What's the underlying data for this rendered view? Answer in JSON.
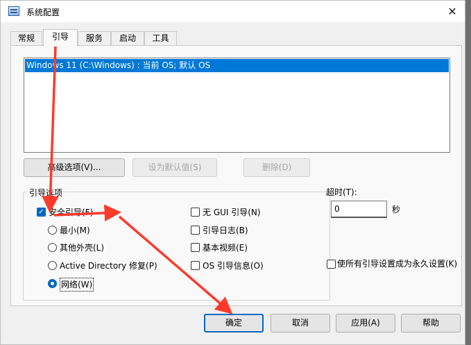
{
  "window": {
    "title": "系统配置",
    "close_glyph": "✕"
  },
  "tabs": [
    {
      "label": "常规"
    },
    {
      "label": "引导"
    },
    {
      "label": "服务"
    },
    {
      "label": "启动"
    },
    {
      "label": "工具"
    }
  ],
  "os_list": {
    "items": [
      "Windows 11 (C:\\Windows) : 当前 OS; 默认 OS"
    ]
  },
  "boot_buttons": {
    "advanced": "高级选项(V)...",
    "set_default": "设为默认值(S)",
    "delete": "删除(D)"
  },
  "boot_options": {
    "title": "引导选项",
    "safe_boot": {
      "label": "安全引导(F)",
      "checked": true
    },
    "radios": [
      {
        "label": "最小(M)",
        "selected": false
      },
      {
        "label": "其他外壳(L)",
        "selected": false
      },
      {
        "label": "Active Directory 修复(P)",
        "selected": false
      },
      {
        "label": "网络(W)",
        "selected": true
      }
    ],
    "checkboxes": [
      {
        "label": "无 GUI 引导(N)",
        "checked": false
      },
      {
        "label": "引导日志(B)",
        "checked": false
      },
      {
        "label": "基本视频(E)",
        "checked": false
      },
      {
        "label": "OS 引导信息(O)",
        "checked": false
      }
    ]
  },
  "timeout": {
    "label": "超时(T):",
    "value": "0",
    "unit": "秒"
  },
  "permanent": {
    "label": "使所有引导设置成为永久设置(K)",
    "checked": false
  },
  "footer": {
    "ok": "确定",
    "cancel": "取消",
    "apply": "应用(A)",
    "help": "帮助"
  },
  "colors": {
    "accent": "#0067c0",
    "selection": "#0078d7",
    "annotation_arrow": "#ff3a2a"
  }
}
